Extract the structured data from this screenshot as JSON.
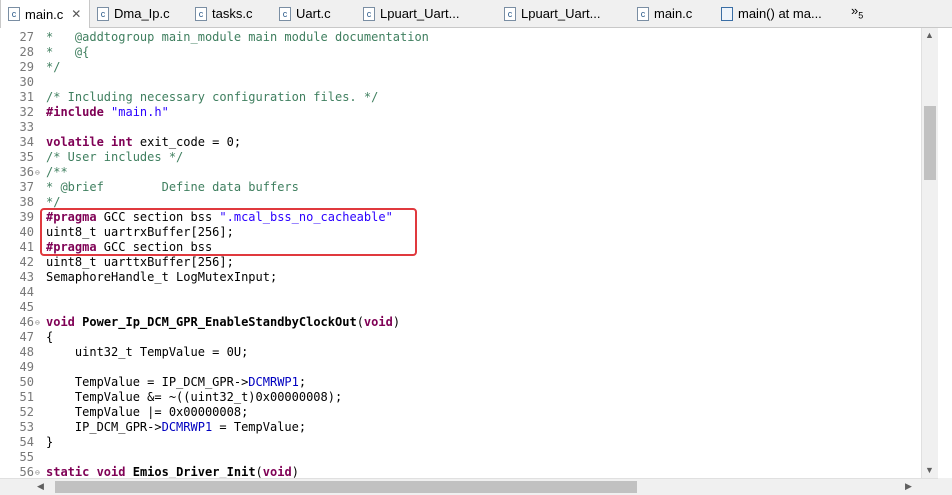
{
  "tabs": [
    {
      "label": "main.c",
      "icon": "c-file-icon",
      "active": true,
      "close": "✕"
    },
    {
      "label": "Dma_Ip.c",
      "icon": "c-file-icon"
    },
    {
      "label": "tasks.c",
      "icon": "c-file-icon"
    },
    {
      "label": "Uart.c",
      "icon": "c-file-icon"
    },
    {
      "label": "Lpuart_Uart...",
      "icon": "c-file-icon"
    },
    {
      "label": "Lpuart_Uart...",
      "icon": "c-file-icon"
    },
    {
      "label": "main.c",
      "icon": "c-file-icon"
    },
    {
      "label": "main() at ma...",
      "icon": "function-icon"
    }
  ],
  "tab_overflow": {
    "symbol": "»",
    "count": "5"
  },
  "editor": {
    "lines": [
      {
        "n": "27",
        "segs": [
          {
            "t": "*   @addtogroup main_module main module documentation",
            "c": "cm"
          }
        ]
      },
      {
        "n": "28",
        "segs": [
          {
            "t": "*   @{",
            "c": "cm"
          }
        ]
      },
      {
        "n": "29",
        "segs": [
          {
            "t": "*/",
            "c": "cm"
          }
        ]
      },
      {
        "n": "30",
        "segs": []
      },
      {
        "n": "31",
        "segs": [
          {
            "t": "/* Including necessary configuration files. */",
            "c": "cm"
          }
        ]
      },
      {
        "n": "32",
        "segs": [
          {
            "t": "#include ",
            "c": "pp"
          },
          {
            "t": "\"main.h\"",
            "c": "str"
          }
        ]
      },
      {
        "n": "33",
        "segs": []
      },
      {
        "n": "34",
        "segs": [
          {
            "t": "volatile int",
            "c": "kw"
          },
          {
            "t": " exit_code = 0;",
            "c": ""
          }
        ]
      },
      {
        "n": "35",
        "segs": [
          {
            "t": "/* User includes */",
            "c": "cm"
          }
        ]
      },
      {
        "n": "36",
        "segs": [
          {
            "t": "/**",
            "c": "cm"
          }
        ],
        "fold": true
      },
      {
        "n": "37",
        "segs": [
          {
            "t": "* @brief        Define data buffers",
            "c": "cm"
          }
        ]
      },
      {
        "n": "38",
        "segs": [
          {
            "t": "*/",
            "c": "cm"
          }
        ]
      },
      {
        "n": "39",
        "segs": [
          {
            "t": "#pragma",
            "c": "pp"
          },
          {
            "t": " GCC section bss ",
            "c": ""
          },
          {
            "t": "\".mcal_bss_no_cacheable\"",
            "c": "str"
          }
        ]
      },
      {
        "n": "40",
        "segs": [
          {
            "t": "uint8_t uartrxBuffer[256];",
            "c": ""
          }
        ]
      },
      {
        "n": "41",
        "segs": [
          {
            "t": "#pragma",
            "c": "pp"
          },
          {
            "t": " GCC section bss",
            "c": ""
          }
        ]
      },
      {
        "n": "42",
        "segs": [
          {
            "t": "uint8_t uarttxBuffer[256];",
            "c": ""
          }
        ]
      },
      {
        "n": "43",
        "segs": [
          {
            "t": "SemaphoreHandle_t LogMutexInput;",
            "c": ""
          }
        ]
      },
      {
        "n": "44",
        "segs": []
      },
      {
        "n": "45",
        "segs": []
      },
      {
        "n": "46",
        "segs": [
          {
            "t": "void",
            "c": "kw"
          },
          {
            "t": " ",
            "c": ""
          },
          {
            "t": "Power_Ip_DCM_GPR_EnableStandbyClockOut",
            "c": "fnname"
          },
          {
            "t": "(",
            "c": ""
          },
          {
            "t": "void",
            "c": "kw"
          },
          {
            "t": ")",
            "c": ""
          }
        ],
        "fold": true
      },
      {
        "n": "47",
        "segs": [
          {
            "t": "{",
            "c": ""
          }
        ]
      },
      {
        "n": "48",
        "segs": [
          {
            "t": "    uint32_t TempValue = 0U;",
            "c": ""
          }
        ]
      },
      {
        "n": "49",
        "segs": []
      },
      {
        "n": "50",
        "segs": [
          {
            "t": "    TempValue = IP_DCM_GPR->",
            "c": ""
          },
          {
            "t": "DCMRWP1",
            "c": "field"
          },
          {
            "t": ";",
            "c": ""
          }
        ]
      },
      {
        "n": "51",
        "segs": [
          {
            "t": "    TempValue &= ~((uint32_t)0x00000008);",
            "c": ""
          }
        ]
      },
      {
        "n": "52",
        "segs": [
          {
            "t": "    TempValue |= 0x00000008;",
            "c": ""
          }
        ]
      },
      {
        "n": "53",
        "segs": [
          {
            "t": "    IP_DCM_GPR->",
            "c": ""
          },
          {
            "t": "DCMRWP1",
            "c": "field"
          },
          {
            "t": " = TempValue;",
            "c": ""
          }
        ]
      },
      {
        "n": "54",
        "segs": [
          {
            "t": "}",
            "c": ""
          }
        ]
      },
      {
        "n": "55",
        "segs": []
      },
      {
        "n": "56",
        "segs": [
          {
            "t": "static void",
            "c": "kw"
          },
          {
            "t": " ",
            "c": ""
          },
          {
            "t": "Emios_Driver_Init",
            "c": "fnname"
          },
          {
            "t": "(",
            "c": ""
          },
          {
            "t": "void",
            "c": "kw"
          },
          {
            "t": ")",
            "c": ""
          }
        ],
        "fold": true
      }
    ]
  },
  "colors": {
    "highlight_box": "#e0393e",
    "comment": "#3f7f5f",
    "keyword": "#7f0055",
    "string": "#2a00ff",
    "field": "#0000c0"
  }
}
